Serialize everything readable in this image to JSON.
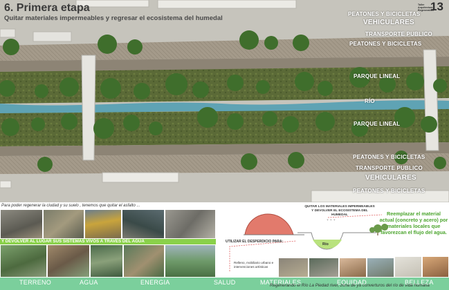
{
  "header": {
    "title": "6. Primera etapa",
    "subtitle": "Quitar materiales impermeables y regresar el ecosistema del humedal",
    "logo_number": "13",
    "logo_text": "Taller Arquitectura Regenerativa"
  },
  "plan_labels": {
    "top": [
      "PEATONES Y BICICLETAS",
      "VEHICULARES",
      "TRANSPORTE PUBLICO",
      "PEATONES Y BICICLETAS"
    ],
    "middle": [
      "PARQUE LINEAL",
      "RÍO",
      "PARQUE LINEAL"
    ],
    "bottom": [
      "PEATONES Y BICICLETAS",
      "TRANSPORTE PUBLICO",
      "VEHICULARES",
      "PEATONES Y BICICLETAS"
    ]
  },
  "photos": {
    "caption_top": "Para poder regenerar la ciudad y su suelo , tenemos que quitar el asfalto ...",
    "caption_band": "Y DEVOLVER AL LUGAR SUS SISTEMAS VIVOS A TRAVES DEL AGUA"
  },
  "diagram": {
    "label_quitar": "QUITAR LOS MATERIALES IMPERMEABLES Y DEVOLVER EL ECOSISTEMA DEL HUMEDAL",
    "label_utilizar": "UTILIZAR EL DESPERDICIO PARA:",
    "label_relleno": "Relleno, mobiliario urbano e intervenciones artísticas",
    "label_rio": "Río",
    "green_text": "Reemplazar el material actual (concreto y acero) por materiales locales que favorezcan el flujo del agua."
  },
  "bottom_bar": {
    "items": [
      "TERRENO",
      "AGUA",
      "ENERGIA",
      "SALUD",
      "MATERIALES",
      "EQUIDAD",
      "BELLEZA"
    ],
    "tagline": "Regenerando el Río La Piedad river, zona de ya converturos del río de vida humana"
  },
  "colors": {
    "green_band": "#8ad14a",
    "bar": "#7bcf9c",
    "green_text": "#4ca52e",
    "river": "#5fa3b4"
  }
}
